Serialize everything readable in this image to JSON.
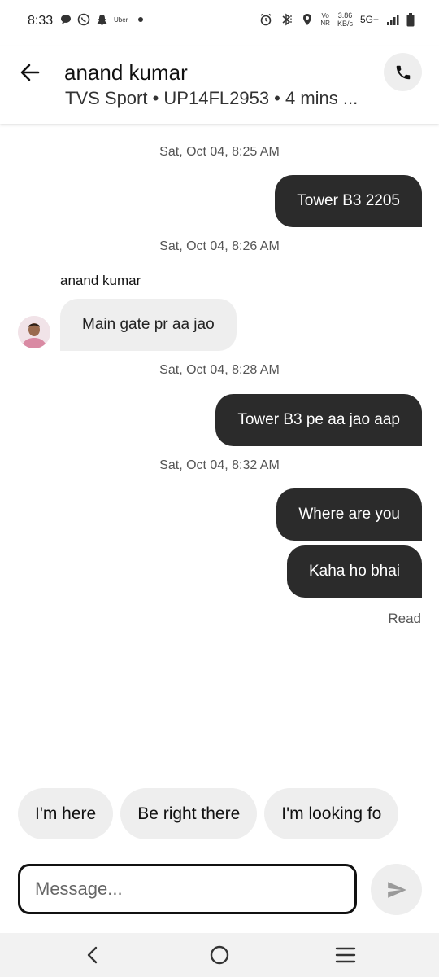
{
  "status_bar": {
    "time": "8:33",
    "uber_label": "Uber",
    "vo_top": "Vo",
    "vo_bottom": "NR",
    "speed_value": "3.86",
    "speed_unit": "KB/s",
    "network": "5G+"
  },
  "header": {
    "title": "anand kumar",
    "subtitle": "TVS Sport • UP14FL2953 • 4 mins ..."
  },
  "messages": {
    "ts1": "Sat, Oct 04, 8:25 AM",
    "m1": "Tower B3 2205",
    "ts2": "Sat, Oct 04, 8:26 AM",
    "sender": "anand kumar",
    "m2": "Main gate pr aa jao",
    "ts3": "Sat, Oct 04, 8:28 AM",
    "m3": "Tower B3 pe aa jao aap",
    "ts4": "Sat, Oct 04, 8:32 AM",
    "m4": "Where are you",
    "m5": "Kaha ho bhai",
    "read": "Read"
  },
  "quick_replies": [
    "I'm here",
    "Be right there",
    "I'm looking fo"
  ],
  "composer": {
    "placeholder": "Message..."
  },
  "icons": {
    "back": "arrow-left-icon",
    "call": "phone-icon",
    "send": "send-icon",
    "nav_back": "chevron-left-icon",
    "nav_home": "circle-home-icon",
    "nav_menu": "menu-icon"
  },
  "colors": {
    "outgoing_bubble": "#2b2b2b",
    "incoming_bubble": "#eeeeee",
    "chip_bg": "#eeeeee"
  }
}
